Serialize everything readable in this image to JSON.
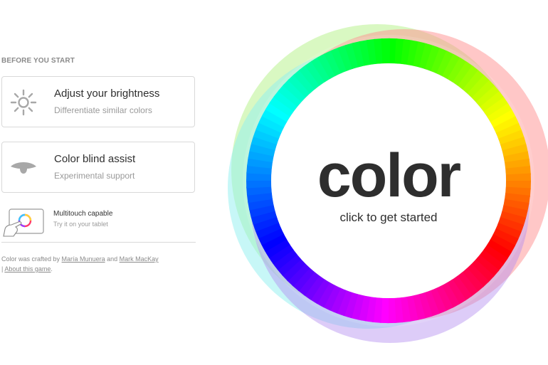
{
  "sidebar": {
    "heading": "BEFORE YOU START",
    "brightness": {
      "title": "Adjust your brightness",
      "subtitle": "Differentiate similar colors",
      "icon": "sun-icon"
    },
    "colorblind": {
      "title": "Color blind assist",
      "subtitle": "Experimental support",
      "icon": "eye-icon"
    },
    "multitouch": {
      "title": "Multitouch capable",
      "subtitle": "Try it on your tablet",
      "icon": "tablet-hand-icon"
    },
    "credits": {
      "prefix": "Color was crafted by ",
      "author1": "María Munuera",
      "and": " and ",
      "author2": "Mark MacKay",
      "separator": " | ",
      "about": "About this game",
      "suffix": "."
    }
  },
  "start": {
    "logo": "color",
    "cta": "click to get started"
  },
  "colors": {
    "text_dark": "#2e2e2e",
    "text_muted": "#9a9a9a",
    "border": "#d9d9d9",
    "halo_green": "#b9f28f",
    "halo_cyan": "#8ff0f0",
    "halo_red": "#ff8f8f",
    "halo_violet": "#b48ff0"
  }
}
